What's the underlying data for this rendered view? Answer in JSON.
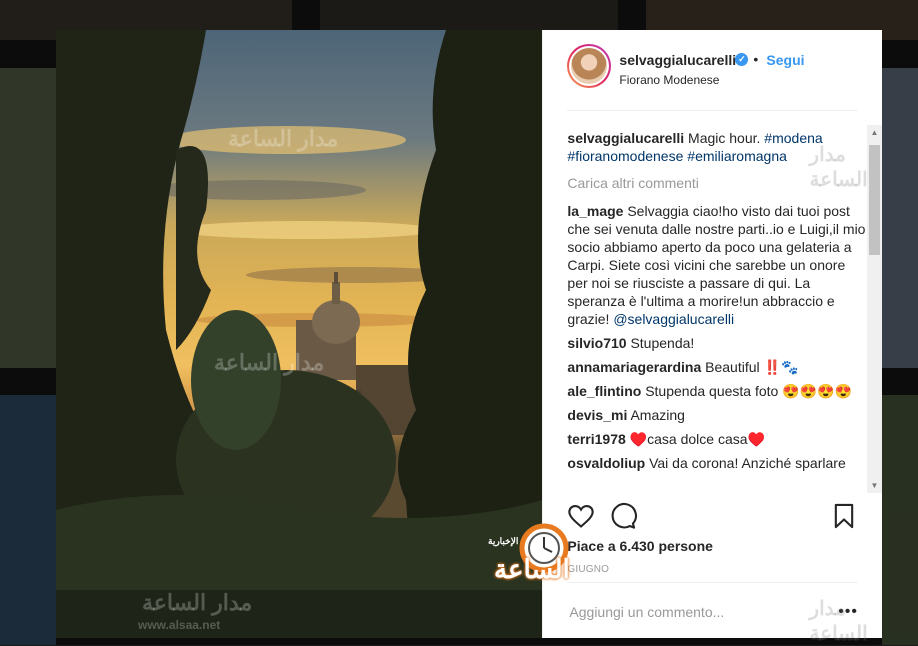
{
  "post": {
    "username": "selvaggialucarelli",
    "follow_label": "Segui",
    "separator": "•",
    "location": "Fiorano Modenese",
    "verified_icon": "✓"
  },
  "caption": {
    "username": "selvaggialucarelli",
    "text": "Magic hour.",
    "tag1": "#modena",
    "tag2": "#fioranomodenese",
    "tag3": "#emiliaromagna"
  },
  "load_more": "Carica altri commenti",
  "comments": [
    {
      "username": "la_mage",
      "text": "Selvaggia ciao!ho visto dai tuoi post che sei venuta dalle nostre parti..io e Luigi,il mio socio abbiamo aperto da poco una gelateria a Carpi. Siete così vicini che sarebbe un onore per noi se riusciste a passare di qui. La speranza è l'ultima a morire!un abbraccio e grazie!",
      "mention": "@selvaggialucarelli"
    },
    {
      "username": "silvio710",
      "text": "Stupenda!"
    },
    {
      "username": "annamariagerardina",
      "text": "Beautiful ‼️🐾"
    },
    {
      "username": "ale_flintino",
      "text": "Stupenda questa foto 😍😍😍😍"
    },
    {
      "username": "devis_mi",
      "text": "Amazing"
    },
    {
      "username": "terri1978",
      "text": "♥️casa dolce casa♥️"
    },
    {
      "username": "osvaldoliup",
      "text": "Vai da corona! Anziché sparlare"
    }
  ],
  "likes_text": "Piace a 6.430 persone",
  "date_text": "GIUGNO",
  "add_comment_placeholder": "Aggiungi un commento...",
  "options_label": "•••",
  "watermark": {
    "brand": "مدار الساعة",
    "url": "www.alsaa.net",
    "logo_small": "الإخبارية",
    "logo_big": "الساعة"
  },
  "colors": {
    "link_blue": "#3897f0",
    "hashtag": "#003569",
    "muted": "#999999"
  },
  "icons": [
    "heart-icon",
    "comment-icon",
    "bookmark-icon",
    "verified-icon",
    "more-options-icon"
  ]
}
